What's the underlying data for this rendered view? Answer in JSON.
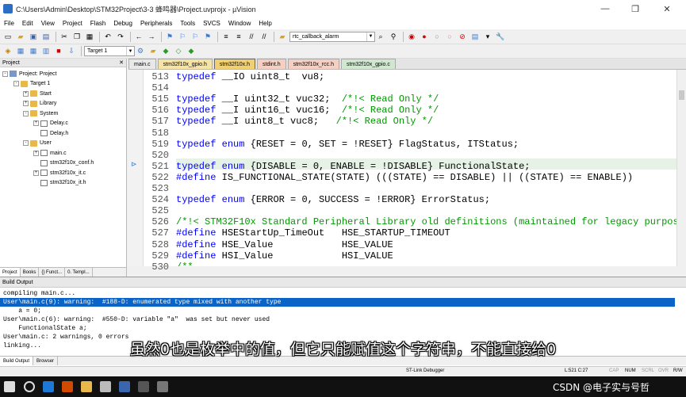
{
  "window": {
    "title": "C:\\Users\\Admin\\Desktop\\STM32Project\\3-3 蜂鸣器\\Project.uvprojx - µVision",
    "minimize": "—",
    "restore": "❐",
    "close": "✕"
  },
  "menu": [
    "File",
    "Edit",
    "View",
    "Project",
    "Flash",
    "Debug",
    "Peripherals",
    "Tools",
    "SVCS",
    "Window",
    "Help"
  ],
  "toolbar": {
    "find_combo": "rtc_callback_alarm",
    "target_combo": "Target 1"
  },
  "project_panel": {
    "title": "Project",
    "close": "✕",
    "tree": [
      {
        "label": "Project: Project",
        "level": 0,
        "kind": "root",
        "expand": "-"
      },
      {
        "label": "Target 1",
        "level": 1,
        "kind": "folder",
        "expand": "-"
      },
      {
        "label": "Start",
        "level": 2,
        "kind": "folder",
        "expand": "+"
      },
      {
        "label": "Library",
        "level": 2,
        "kind": "folder",
        "expand": "+"
      },
      {
        "label": "System",
        "level": 2,
        "kind": "folder",
        "expand": "-"
      },
      {
        "label": "Delay.c",
        "level": 3,
        "kind": "file",
        "expand": "+"
      },
      {
        "label": "Delay.h",
        "level": 3,
        "kind": "file",
        "expand": ""
      },
      {
        "label": "User",
        "level": 2,
        "kind": "folder",
        "expand": "-"
      },
      {
        "label": "main.c",
        "level": 3,
        "kind": "file",
        "expand": "+"
      },
      {
        "label": "stm32f10x_conf.h",
        "level": 3,
        "kind": "file",
        "expand": ""
      },
      {
        "label": "stm32f10x_it.c",
        "level": 3,
        "kind": "file",
        "expand": "+"
      },
      {
        "label": "stm32f10x_it.h",
        "level": 3,
        "kind": "file",
        "expand": ""
      }
    ],
    "tabs": [
      "Project",
      "Books",
      "{} Funct...",
      "0. Templ..."
    ]
  },
  "editor_tabs": [
    {
      "label": "main.c",
      "color": "#e8e8e8"
    },
    {
      "label": "stm32f10x_gpio.h",
      "color": "#f6e3a6"
    },
    {
      "label": "stm32f10x.h",
      "color": "#f0d070"
    },
    {
      "label": "stdint.h",
      "color": "#f6cfc3"
    },
    {
      "label": "stm32f10x_rcc.h",
      "color": "#f6cfc3"
    },
    {
      "label": "stm32f10x_gpio.c",
      "color": "#cfe8cf"
    }
  ],
  "code_lines": [
    {
      "num": "513",
      "parts": [
        {
          "t": "typedef",
          "c": "kw"
        },
        {
          "t": " __IO uint8_t  vu8;",
          "c": ""
        }
      ]
    },
    {
      "num": "514",
      "parts": []
    },
    {
      "num": "515",
      "parts": [
        {
          "t": "typedef",
          "c": "kw"
        },
        {
          "t": " __I uint32_t vuc32;  ",
          "c": ""
        },
        {
          "t": "/*!< Read Only */",
          "c": "cm"
        }
      ]
    },
    {
      "num": "516",
      "parts": [
        {
          "t": "typedef",
          "c": "kw"
        },
        {
          "t": " __I uint16_t vuc16;  ",
          "c": ""
        },
        {
          "t": "/*!< Read Only */",
          "c": "cm"
        }
      ]
    },
    {
      "num": "517",
      "parts": [
        {
          "t": "typedef",
          "c": "kw"
        },
        {
          "t": " __I uint8_t vuc8;   ",
          "c": ""
        },
        {
          "t": "/*!< Read Only */",
          "c": "cm"
        }
      ]
    },
    {
      "num": "518",
      "parts": []
    },
    {
      "num": "519",
      "parts": [
        {
          "t": "typedef",
          "c": "kw"
        },
        {
          "t": " ",
          "c": ""
        },
        {
          "t": "enum",
          "c": "kw"
        },
        {
          "t": " {RESET = 0, SET = !RESET} FlagStatus, ITStatus;",
          "c": ""
        }
      ]
    },
    {
      "num": "520",
      "parts": []
    },
    {
      "num": "521",
      "parts": [
        {
          "t": "typedef",
          "c": "kw"
        },
        {
          "t": " ",
          "c": ""
        },
        {
          "t": "enum",
          "c": "kw"
        },
        {
          "t": " {DISABLE = 0, ENABLE = !DISABLE} FunctionalState;",
          "c": ""
        }
      ]
    },
    {
      "num": "522",
      "parts": [
        {
          "t": "#define",
          "c": "kw"
        },
        {
          "t": " IS_FUNCTIONAL_STATE(STATE) (((STATE) == DISABLE) || ((STATE) == ENABLE))",
          "c": ""
        }
      ]
    },
    {
      "num": "523",
      "parts": []
    },
    {
      "num": "524",
      "parts": [
        {
          "t": "typedef",
          "c": "kw"
        },
        {
          "t": " ",
          "c": ""
        },
        {
          "t": "enum",
          "c": "kw"
        },
        {
          "t": " {ERROR = 0, SUCCESS = !ERROR} ErrorStatus;",
          "c": ""
        }
      ]
    },
    {
      "num": "525",
      "parts": []
    },
    {
      "num": "526",
      "parts": [
        {
          "t": "/*!< STM32F10x Standard Peripheral Library old definitions (maintained for legacy purpose)",
          "c": "cm"
        }
      ]
    },
    {
      "num": "527",
      "parts": [
        {
          "t": "#define",
          "c": "kw"
        },
        {
          "t": " HSEStartUp_TimeOut   HSE_STARTUP_TIMEOUT",
          "c": ""
        }
      ]
    },
    {
      "num": "528",
      "parts": [
        {
          "t": "#define",
          "c": "kw"
        },
        {
          "t": " HSE_Value            HSE_VALUE",
          "c": ""
        }
      ]
    },
    {
      "num": "529",
      "parts": [
        {
          "t": "#define",
          "c": "kw"
        },
        {
          "t": " HSI_Value            HSI_VALUE",
          "c": ""
        }
      ]
    },
    {
      "num": "530",
      "parts": [
        {
          "t": "/**",
          "c": "cm"
        }
      ]
    }
  ],
  "build_output": {
    "title": "Build Output",
    "lines": [
      "compiling main.c...",
      "User\\main.c(9): warning:  #188-D: enumerated type mixed with another type",
      "    a = 0;",
      "User\\main.c(6): warning:  #550-D: variable \"a\"  was set but never used",
      "    FunctionalState a;",
      "User\\main.c: 2 warnings, 0 errors",
      "linking..."
    ],
    "tabs": [
      "Build Output",
      "Browser"
    ]
  },
  "status": {
    "debugger": "ST-Link Debugger",
    "cursor": "L:521 C:27",
    "caps": "CAP",
    "num": "NUM",
    "scrl": "SCRL",
    "ovr": "OVR",
    "rw": "R/W"
  },
  "subtitle": "虽然0也是枚举中的值，但它只能赋值这个字符串，不能直接给0",
  "watermark": "CSDN @电子实与号哲"
}
